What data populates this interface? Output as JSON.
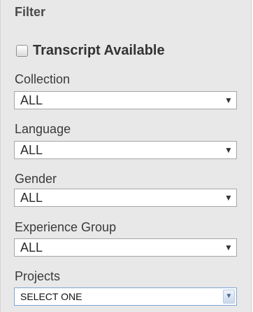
{
  "filter": {
    "title": "Filter",
    "transcript_available": {
      "label": "Transcript Available",
      "checked": false
    },
    "fields": [
      {
        "label": "Collection",
        "value": "ALL"
      },
      {
        "label": "Language",
        "value": "ALL"
      },
      {
        "label": "Gender",
        "value": "ALL"
      },
      {
        "label": "Experience Group",
        "value": "ALL"
      },
      {
        "label": "Projects",
        "value": "SELECT ONE"
      }
    ]
  },
  "icons": {
    "dropdown_arrow": "caret-down-icon",
    "projects_arrow": "chevron-down-icon"
  }
}
